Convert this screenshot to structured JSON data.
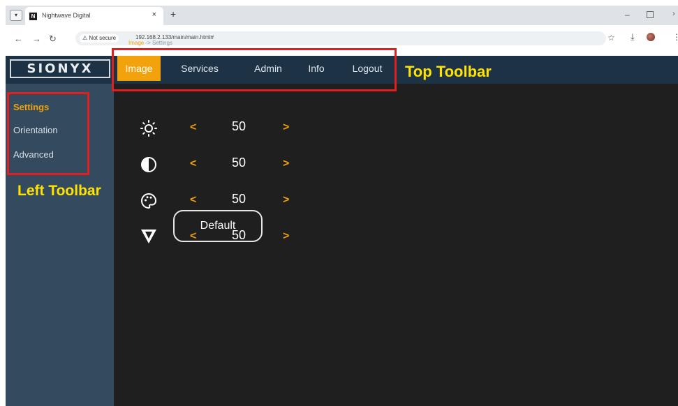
{
  "browser": {
    "tab_title": "Nightwave Digital",
    "favicon_letter": "N",
    "tab_close": "×",
    "new_tab": "+",
    "dropdown": "▾",
    "back": "←",
    "forward": "→",
    "reload": "↻",
    "not_secure": "⚠ Not secure",
    "url": "192.168.2.133/main/main.html#",
    "star": "☆",
    "download": "⤓",
    "menu": "⋮",
    "min": "–",
    "more": "›"
  },
  "app": {
    "logo": "SIONYX",
    "nav": [
      "Image",
      "Services",
      "Admin",
      "Info",
      "Logout"
    ],
    "sidebar": [
      "Settings",
      "Orientation",
      "Advanced"
    ],
    "breadcrumb": {
      "current": "Image",
      "sep": " -> ",
      "page": "Settings"
    },
    "controls": [
      {
        "icon": "brightness-icon",
        "value": "50"
      },
      {
        "icon": "contrast-icon",
        "value": "50"
      },
      {
        "icon": "color-palette-icon",
        "value": "50"
      },
      {
        "icon": "gamma-icon",
        "value": "50"
      }
    ],
    "arrow_left": "<",
    "arrow_right": ">",
    "default_button": "Default"
  },
  "annotations": {
    "top_toolbar": "Top Toolbar",
    "left_toolbar": "Left Toolbar",
    "color": "#e02020"
  },
  "colors": {
    "accent": "#f2a20c",
    "topbar": "#1d3244",
    "sidebar": "#344b5f",
    "content": "#1f1f1f"
  }
}
